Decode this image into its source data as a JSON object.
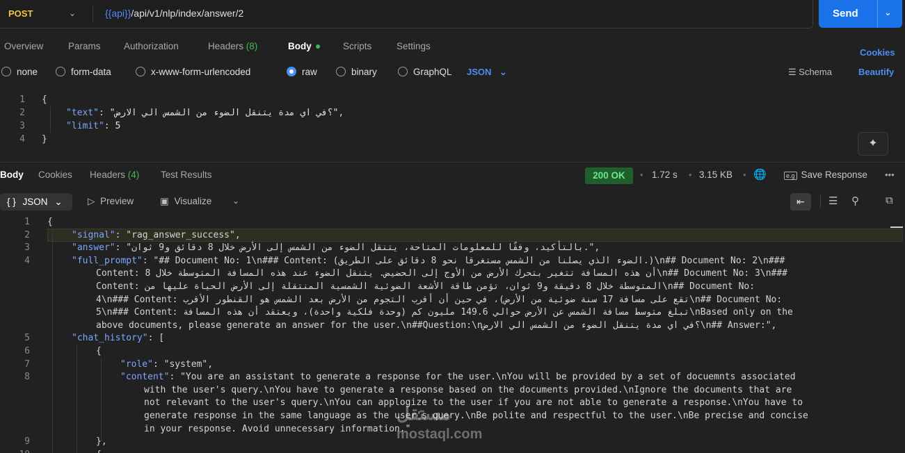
{
  "request": {
    "method": "POST",
    "url_var": "{{api}}",
    "url_path": "/api/v1/nlp/index/answer/2",
    "send_label": "Send"
  },
  "request_tabs": [
    {
      "label": "Overview"
    },
    {
      "label": "Params"
    },
    {
      "label": "Authorization"
    },
    {
      "label": "Headers",
      "count": "(8)"
    },
    {
      "label": "Body"
    },
    {
      "label": "Scripts"
    },
    {
      "label": "Settings"
    }
  ],
  "cookies_label": "Cookies",
  "body_types": [
    "none",
    "form-data",
    "x-www-form-urlencoded",
    "raw",
    "binary",
    "GraphQL"
  ],
  "body_format": "JSON",
  "schema_label": "Schema",
  "beautify_label": "Beautify",
  "request_body": {
    "line_numbers": [
      "1",
      "2",
      "3",
      "4"
    ],
    "open": "{",
    "close": "}",
    "text_key": "\"text\"",
    "text_value": "\"؟في اي مدة يتنقل الضوء من الشمس الي الارض\"",
    "limit_key": "\"limit\"",
    "limit_value": "5"
  },
  "response_tabs": [
    {
      "label": "Body"
    },
    {
      "label": "Cookies"
    },
    {
      "label": "Headers",
      "count": "(4)"
    },
    {
      "label": "Test Results"
    }
  ],
  "response_meta": {
    "status": "200 OK",
    "time": "1.72 s",
    "size": "3.15 KB",
    "save_label": "Save Response"
  },
  "view": {
    "format": "JSON",
    "preview_label": "Preview",
    "visualize_label": "Visualize"
  },
  "response_lines": [
    {
      "n": "1",
      "text": "{"
    },
    {
      "n": "2",
      "key": "\"signal\"",
      "value": "\"rag_answer_success\","
    },
    {
      "n": "3",
      "key": "\"answer\"",
      "value": "\"بالتأكيد، وفقًا للمعلومات المتاحة، يتنقل الضوء من الشمس إلى الأرض خلال 8 دقائق و9 ثوان.\","
    },
    {
      "n": "4",
      "key": "\"full_prompt\"",
      "value": "\"## Document No: 1\\n### Content: (الضوء الذي يصلنا من الشمس مستغرقا نحو 8 دقائق على الطريق.)\\n## Document No: 2\\n###"
    },
    {
      "n": "",
      "value": "Content: أن هذه المسافة تتغير بتحرك الأرض من الأوج إلى الحضيض. يتنقل الضوء عند هذه المسافة المتوسطة خلال 8\\n## Document No: 3\\n###"
    },
    {
      "n": "",
      "value": "Content: المتوسطة خلال 8 دقيقة و9 ثوان، تؤمن طاقة الأشعة الضوئية الشمسية المنتقلة إلى الأرض الحياة عليها من\\n## Document No:"
    },
    {
      "n": "",
      "value": "4\\n### Content: تقع على مسافة 17 سنة ضوئية من الأرض)، في حين أن أقرب التجوم من الأرض بعد الشمس هو القنطور الأقرب\\n## Document No:"
    },
    {
      "n": "",
      "value": "5\\n### Content: تبلغ متوسط مسافة الشمس عن الأرض حوالي 149.6 مليون كم (وحدة فلكية واحدة)، ويعتقد أن هذه المسافة\\nBased only on the"
    },
    {
      "n": "",
      "value": "above documents, please generate an answer for the user.\\n##Question:\\n؟في اي مدة يتنقل الضوء من الشمس الي الارض\\n## Answer:\","
    },
    {
      "n": "5",
      "key": "\"chat_history\"",
      "value": "["
    },
    {
      "n": "6",
      "text": "{"
    },
    {
      "n": "7",
      "key": "\"role\"",
      "value": "\"system\","
    },
    {
      "n": "8",
      "key": "\"content\"",
      "value": "\"You are an assistant to generate a response for the user.\\nYou will be provided by a set of docuemnts associated"
    },
    {
      "n": "",
      "value": "with the user's query.\\nYou have to generate a response based on the documents provided.\\nIgnore the documents that are"
    },
    {
      "n": "",
      "value": "not relevant to the user's query.\\nYou can applogize to the user if you are not able to generate a response.\\nYou have to"
    },
    {
      "n": "",
      "value": "generate response in the same language as the user's query.\\nBe polite and respectful to the user.\\nBe precise and concise"
    },
    {
      "n": "",
      "value": "in your response. Avoid unnecessary information.\""
    },
    {
      "n": "9",
      "text": "},"
    },
    {
      "n": "10",
      "text": "{"
    }
  ],
  "watermark": {
    "line1": "مستقل",
    "line2": "mostaql.com"
  },
  "colors": {
    "accent": "#1a73e8",
    "method": "#f5c542",
    "key": "#7aa7ff",
    "status_bg": "#1f5f2b",
    "status_text": "#6fe58a"
  }
}
